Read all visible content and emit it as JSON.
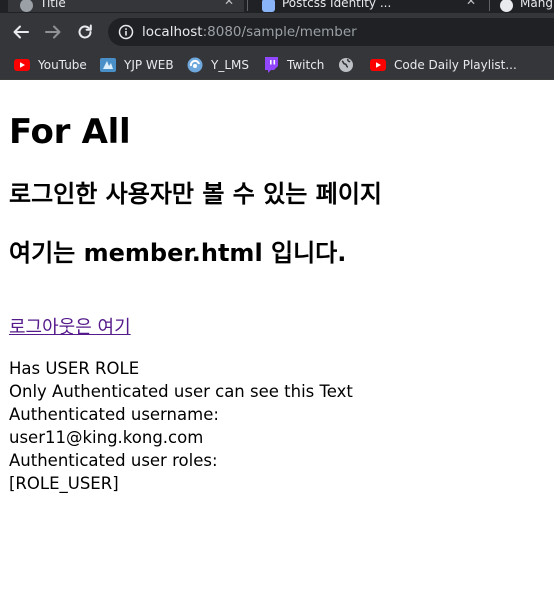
{
  "browser": {
    "tabs": [
      {
        "title": "Title",
        "active": true
      },
      {
        "title": "Postcss Identity ...",
        "active": false
      },
      {
        "title": "Mang",
        "active": false
      }
    ],
    "address_bar": {
      "host": "localhost",
      "rest": ":8080/sample/member"
    },
    "bookmarks": [
      {
        "label": "YouTube",
        "icon": "youtube-icon"
      },
      {
        "label": "YJP WEB",
        "icon": "yjp-icon"
      },
      {
        "label": "Y_LMS",
        "icon": "lms-icon"
      },
      {
        "label": "Twitch",
        "icon": "twitch-icon"
      },
      {
        "label": "",
        "icon": "globe-icon"
      },
      {
        "label": "Code Daily Playlist...",
        "icon": "youtube-icon"
      }
    ],
    "colors": {
      "chrome_dark": "#202124",
      "chrome_toolbar": "#35363a",
      "youtube_red": "#ff0000",
      "twitch_purple": "#9146ff",
      "visited_link": "#551a8b"
    }
  },
  "page": {
    "heading": "For All",
    "subheading_1": "로그인한 사용자만 볼 수 있는 페이지",
    "subheading_2": "여기는 member.html 입니다.",
    "logout_link": "로그아웃은 여기",
    "info_lines": [
      "Has USER ROLE",
      "Only Authenticated user can see this Text",
      "Authenticated username:",
      "user11@king.kong.com",
      "Authenticated user roles:",
      "[ROLE_USER]"
    ]
  }
}
